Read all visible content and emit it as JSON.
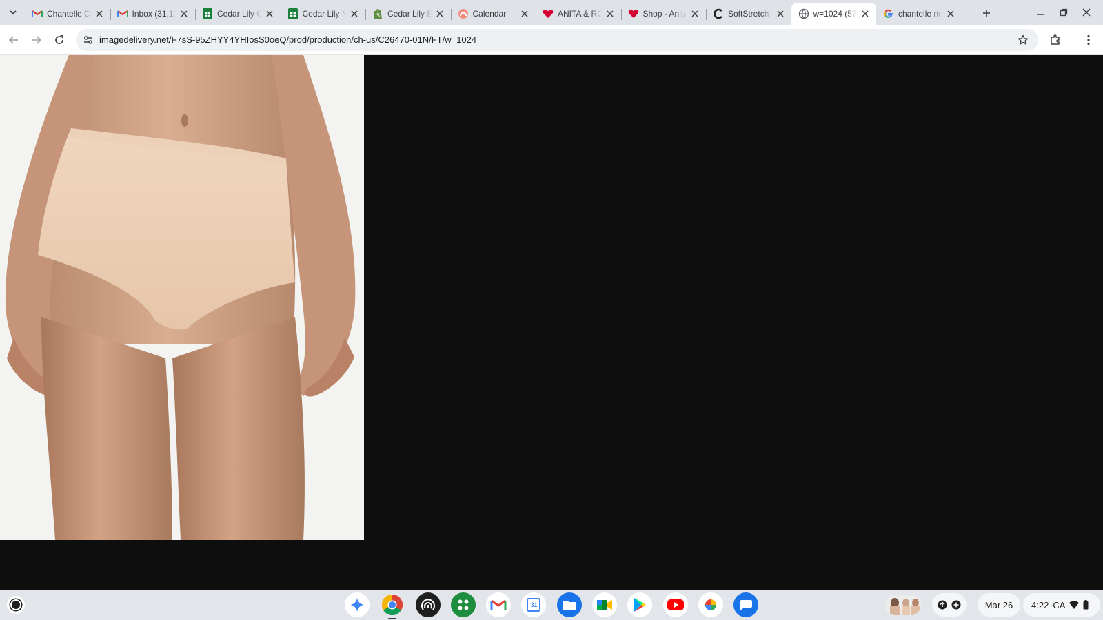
{
  "browser": {
    "tabs": [
      {
        "title": "Chantelle Ca",
        "favicon": "gmail-icon",
        "active": false
      },
      {
        "title": "Inbox (31,13",
        "favicon": "gmail-icon",
        "active": false
      },
      {
        "title": "Cedar Lily O",
        "favicon": "sheets-icon",
        "active": false
      },
      {
        "title": "Cedar Lily M",
        "favicon": "sheets-icon",
        "active": false
      },
      {
        "title": "Cedar Lily B",
        "favicon": "shopify-icon",
        "active": false
      },
      {
        "title": "Calendar",
        "favicon": "calendar-icon",
        "active": false
      },
      {
        "title": "ANITA & RO",
        "favicon": "heart-icon",
        "active": false
      },
      {
        "title": "Shop - Anita",
        "favicon": "heart-icon",
        "active": false
      },
      {
        "title": "SoftStretch",
        "favicon": "c-logo-icon",
        "active": false
      },
      {
        "title": "w=1024 (57",
        "favicon": "globe-icon",
        "active": true
      },
      {
        "title": "chantelle no",
        "favicon": "google-icon",
        "active": false
      }
    ],
    "address_bar": {
      "url": "imagedelivery.net/F7sS-95ZHYY4YHIosS0oeQ/prod/production/ch-us/C26470-01N/FT/w=1024"
    }
  },
  "viewport": {
    "image_description_icon": "product-photo",
    "background": "#0e0e0f"
  },
  "shelf": {
    "apps": [
      {
        "name": "gemini-icon"
      },
      {
        "name": "chrome-icon",
        "running": true
      },
      {
        "name": "podcast-icon"
      },
      {
        "name": "app-grid-icon"
      },
      {
        "name": "gmail-icon"
      },
      {
        "name": "calendar-icon",
        "label": "31"
      },
      {
        "name": "files-icon"
      },
      {
        "name": "meet-icon"
      },
      {
        "name": "play-store-icon"
      },
      {
        "name": "youtube-icon"
      },
      {
        "name": "photos-icon"
      },
      {
        "name": "messages-icon"
      }
    ],
    "date": "Mar 26",
    "time": "4:22",
    "locale": "CA"
  },
  "colors": {
    "tabstrip": "#dfe3e8",
    "toolbar": "#ffffff",
    "omnibox": "#eef1f4",
    "shelf": "#e2e5e9",
    "viewport": "#0e0e0f"
  }
}
